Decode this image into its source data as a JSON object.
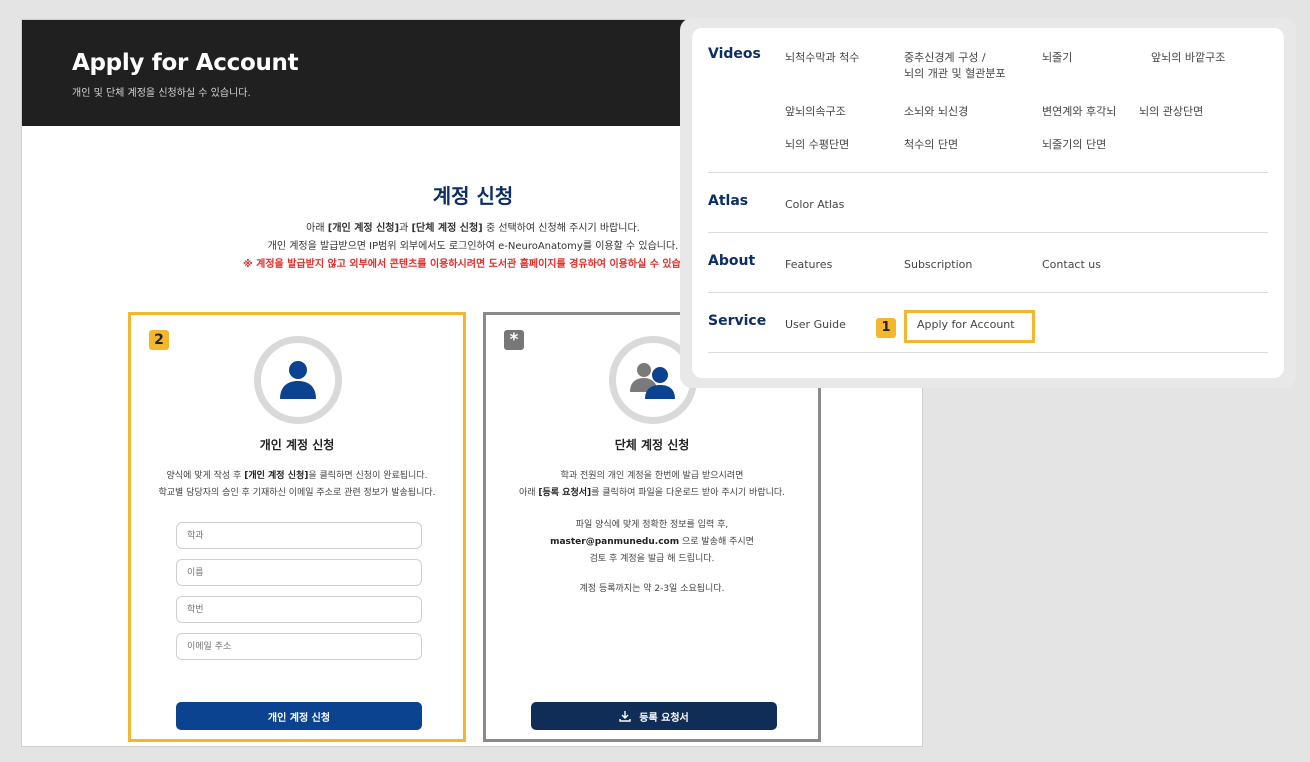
{
  "hero": {
    "title": "Apply for Account",
    "subtitle": "개인 및 단체 계정을 신청하실 수 있습니다."
  },
  "section": {
    "title": "계정 신청",
    "intro1_a": "아래 ",
    "intro1_b": "[개인 계정 신청]",
    "intro1_c": "과 ",
    "intro1_d": "[단체 계정 신청]",
    "intro1_e": " 중 선택하여 신청해 주시기 바랍니다.",
    "intro2": "개인 계정을 발급받으면 IP범위 외부에서도 로그인하여 e-NeuroAnatomy를 이용할 수 있습니다.",
    "intro3": "※ 계정을 발급받지 않고 외부에서 콘텐츠를 이용하시려면 도서관 홈페이지를 경유하여 이용하실 수 있습니다."
  },
  "personal": {
    "badge": "2",
    "title": "개인 계정 신청",
    "desc1_a": "양식에 맞게 작성 후 ",
    "desc1_b": "[개인 계정 신청]",
    "desc1_c": "을 클릭하면 신청이 완료됩니다.",
    "desc2": "학교별 담당자의 승인 후 기재하신 이메일 주소로 관련 정보가 발송됩니다.",
    "fields": [
      {
        "placeholder": "학과"
      },
      {
        "placeholder": "이름"
      },
      {
        "placeholder": "학번"
      },
      {
        "placeholder": "이메일 주소"
      }
    ],
    "button": "개인 계정 신청"
  },
  "group": {
    "badge": "*",
    "title": "단체 계정 신청",
    "desc1": "학과 전원의 개인 계정을 한번에 발급 받으시려면",
    "desc2_a": "아래 ",
    "desc2_b": "[등록 요청서]",
    "desc2_c": "를 클릭하여 파일을 다운로드 받아 주시기 바랍니다.",
    "desc3": "파일 양식에 맞게 정확한 정보를 입력 후,",
    "desc4_a": "master@panmunedu.com",
    "desc4_b": " 으로 발송해 주시면",
    "desc5": "검토 후 계정을 발급 해 드립니다.",
    "desc6": "계정 등록까지는 약 2-3일 소요됩니다.",
    "button": "등록 요청서"
  },
  "menu": {
    "videos": {
      "label": "Videos",
      "items": [
        "뇌척수막과 척수",
        "중추신경계 구성 / 뇌의 개관 및 혈관분포",
        "뇌줄기",
        "앞뇌의 바깥구조",
        "앞뇌의속구조",
        "소뇌와 뇌신경",
        "변연계와 후각뇌",
        "뇌의 관상단면",
        "뇌의 수평단면",
        "척수의 단면",
        "뇌줄기의 단면"
      ]
    },
    "atlas": {
      "label": "Atlas",
      "items": [
        "Color Atlas"
      ]
    },
    "about": {
      "label": "About",
      "items": [
        "Features",
        "Subscription",
        "Contact us"
      ]
    },
    "service": {
      "label": "Service",
      "items": [
        "User Guide",
        "Apply for Account"
      ],
      "badge": "1"
    }
  },
  "colors": {
    "navy": "#0d2e64",
    "accent": "#f4b62e",
    "alert": "#e0302b",
    "primary_button": "#0c4390"
  }
}
